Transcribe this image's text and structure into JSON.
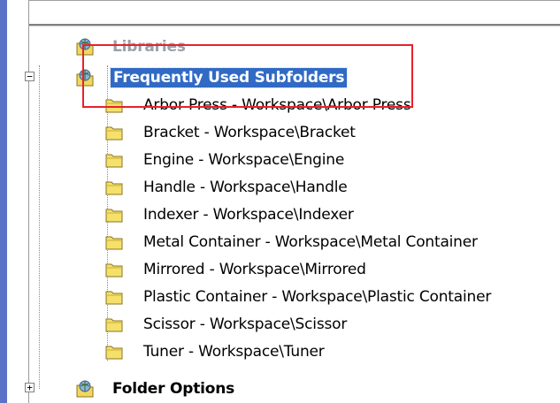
{
  "tree": {
    "libraries_label": "Libraries",
    "fav_folder_label": "Frequently Used Subfolders",
    "folder_options_label": "Folder Options",
    "subfolders": [
      "Arbor Press - Workspace\\Arbor Press",
      "Bracket - Workspace\\Bracket",
      "Engine - Workspace\\Engine",
      "Handle - Workspace\\Handle",
      "Indexer - Workspace\\Indexer",
      "Metal Container - Workspace\\Metal Container",
      "Mirrored - Workspace\\Mirrored",
      "Plastic Container - Workspace\\Plastic Container",
      "Scissor - Workspace\\Scissor",
      "Tuner - Workspace\\Tuner"
    ],
    "expander_collapse": "−",
    "expander_expand": "+"
  },
  "colors": {
    "selection": "#316ac5",
    "highlight_box": "#e8212b",
    "folder_fill": "#f5e06a"
  },
  "icons": {
    "folder": "folder-icon",
    "globe_folder": "globe-folder-icon"
  }
}
